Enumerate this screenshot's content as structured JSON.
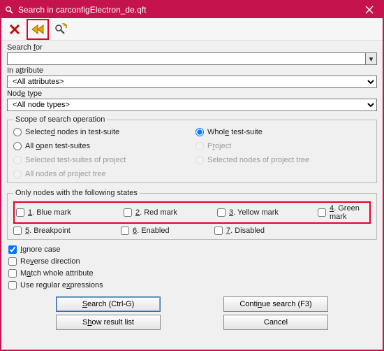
{
  "window": {
    "title": "Search in carconfigElectron_de.qft"
  },
  "fields": {
    "search_for_label": "Search for",
    "search_for_value": "",
    "in_attribute_label": "In attribute",
    "in_attribute_value": "<All attributes>",
    "node_type_label": "Node type",
    "node_type_value": "<All node types>"
  },
  "scope": {
    "legend": "Scope of search operation",
    "opts": {
      "selected_nodes": "Selected nodes in test-suite",
      "whole_suite": "Whole test-suite",
      "open_suites": "All open test-suites",
      "project": "Project",
      "selected_suites_proj": "Selected test-suites of project",
      "selected_nodes_tree": "Selected nodes of project tree",
      "all_nodes_tree": "All nodes of project tree"
    },
    "selected": "whole_suite"
  },
  "states": {
    "legend": "Only nodes with the following states",
    "row1": {
      "blue": "1. Blue mark",
      "red": "2. Red mark",
      "yellow": "3. Yellow mark",
      "green": "4. Green mark"
    },
    "row2": {
      "breakpoint": "5. Breakpoint",
      "enabled": "6. Enabled",
      "disabled": "7. Disabled"
    }
  },
  "options": {
    "ignore_case": {
      "label": "Ignore case",
      "checked": true
    },
    "reverse": {
      "label": "Reverse direction",
      "checked": false
    },
    "match_whole": {
      "label": "Match whole attribute",
      "checked": false
    },
    "regex": {
      "label": "Use regular expressions",
      "checked": false
    }
  },
  "buttons": {
    "search": "Search (Ctrl-G)",
    "show_result": "Show result list",
    "continue": "Continue search (F3)",
    "cancel": "Cancel"
  },
  "icons": {
    "close_x": "✕",
    "chevron_down": "▾"
  }
}
